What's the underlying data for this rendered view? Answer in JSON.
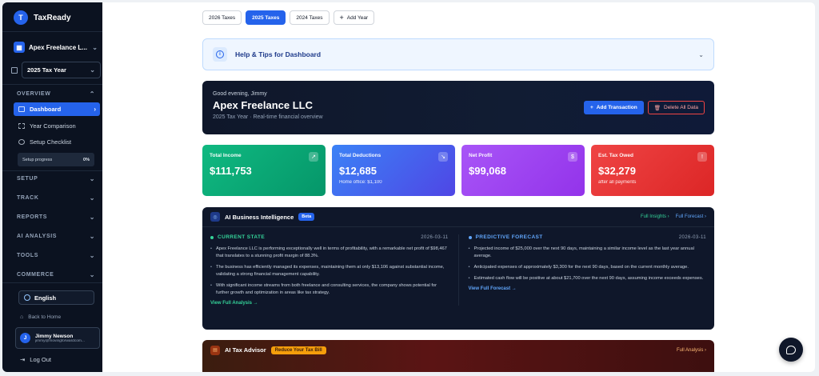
{
  "brand": {
    "logo_letter": "T",
    "name": "TaxReady"
  },
  "company_selector": {
    "label": "Apex Freelance L..."
  },
  "year_selector": {
    "label": "2025 Tax Year"
  },
  "sidebar": {
    "overview_label": "OVERVIEW",
    "items": [
      {
        "label": "Dashboard",
        "active": true
      },
      {
        "label": "Year Comparison"
      },
      {
        "label": "Setup Checklist"
      }
    ],
    "setup_progress": {
      "label": "Setup progress",
      "value": "0%"
    },
    "sections": [
      "SETUP",
      "TRACK",
      "REPORTS",
      "AI ANALYSIS",
      "TOOLS",
      "COMMERCE"
    ],
    "language": "English",
    "back_home": "Back to Home",
    "user": {
      "initial": "J",
      "name": "Jimmy Newson",
      "email": "jimmy@movingforwardcom..."
    },
    "logout": "Log Out"
  },
  "tabs": [
    "2026 Taxes",
    "2025 Taxes",
    "2024 Taxes",
    "Add Year"
  ],
  "help": {
    "title": "Help & Tips for Dashboard"
  },
  "hero": {
    "greeting": "Good evening, Jimmy",
    "title": "Apex Freelance LLC",
    "subtitle": "2025 Tax Year · Real-time financial overview",
    "add_transaction": "Add Transaction",
    "delete_all": "Delete All Data"
  },
  "stats": [
    {
      "label": "Total Income",
      "value": "$111,753",
      "sub": ""
    },
    {
      "label": "Total Deductions",
      "value": "$12,685",
      "sub": "Home office: $1,100"
    },
    {
      "label": "Net Profit",
      "value": "$99,068",
      "sub": ""
    },
    {
      "label": "Est. Tax Owed",
      "value": "$32,279",
      "sub": "after all payments"
    }
  ],
  "ai_intel": {
    "title": "AI Business Intelligence",
    "badge": "Beta",
    "link_insights": "Full Insights ›",
    "link_forecast": "Full Forecast ›",
    "current": {
      "heading": "CURRENT STATE",
      "date": "2026-03-11",
      "bullets": [
        "Apex Freelance LLC is performing exceptionally well in terms of profitability, with a remarkable net profit of $98,467 that translates to a stunning profit margin of 88.3%.",
        "The business has efficiently managed its expenses, maintaining them at only $13,106 against substantial income, validating a strong financial management capability.",
        "With significant income streams from both freelance and consulting services, the company shows potential for further growth and optimization in areas like tax strategy."
      ],
      "link": "View Full Analysis →"
    },
    "forecast": {
      "heading": "PREDICTIVE FORECAST",
      "date": "2026-03-11",
      "bullets": [
        "Projected income of $25,000 over the next 90 days, maintaining a similar income level as the last year annual average.",
        "Anticipated expenses of approximately $3,300 for the next 90 days, based on the current monthly average.",
        "Estimated cash flow will be positive at about $21,700 over the next 90 days, assuming income exceeds expenses."
      ],
      "link": "View Full Forecast →"
    }
  },
  "tax_advisor": {
    "title": "AI Tax Advisor",
    "badge": "Reduce Your Tax Bill",
    "link": "Full Analysis ›"
  },
  "colors": {
    "accent": "#2563eb",
    "income": "#10b981",
    "deductions": "#4f46e5",
    "profit": "#9333ea",
    "tax": "#ef4444"
  }
}
